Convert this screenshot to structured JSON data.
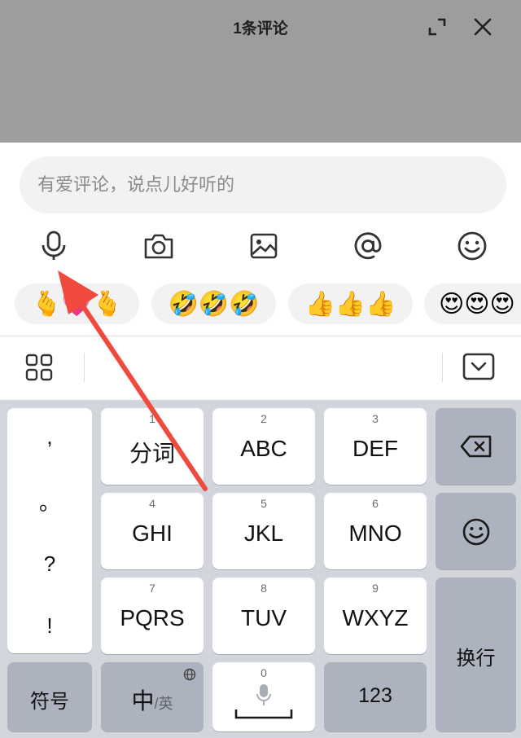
{
  "header": {
    "title": "1条评论"
  },
  "comment": {
    "placeholder": "有爱评论，说点儿好听的"
  },
  "quick_replies": [
    {
      "text": "🫰💗🫰"
    },
    {
      "text": "🤣🤣🤣"
    },
    {
      "text": "👍👍👍"
    },
    {
      "text": "😍😍😍"
    }
  ],
  "keyboard": {
    "punctuation": [
      ",",
      "。",
      "?",
      "!"
    ],
    "keys": [
      {
        "num": "1",
        "label": "分词"
      },
      {
        "num": "2",
        "label": "ABC"
      },
      {
        "num": "3",
        "label": "DEF"
      },
      {
        "num": "4",
        "label": "GHI"
      },
      {
        "num": "5",
        "label": "JKL"
      },
      {
        "num": "6",
        "label": "MNO"
      },
      {
        "num": "7",
        "label": "PQRS"
      },
      {
        "num": "8",
        "label": "TUV"
      },
      {
        "num": "9",
        "label": "WXYZ"
      }
    ],
    "symbols": "符号",
    "lang_main": "中",
    "lang_sub": "/英",
    "space_num": "0",
    "numbers": "123",
    "newline": "换行"
  },
  "colors": {
    "annotation_arrow": "#f04a3e",
    "header_bg": "#9d9d9d",
    "keyboard_bg": "#d2d5db"
  }
}
